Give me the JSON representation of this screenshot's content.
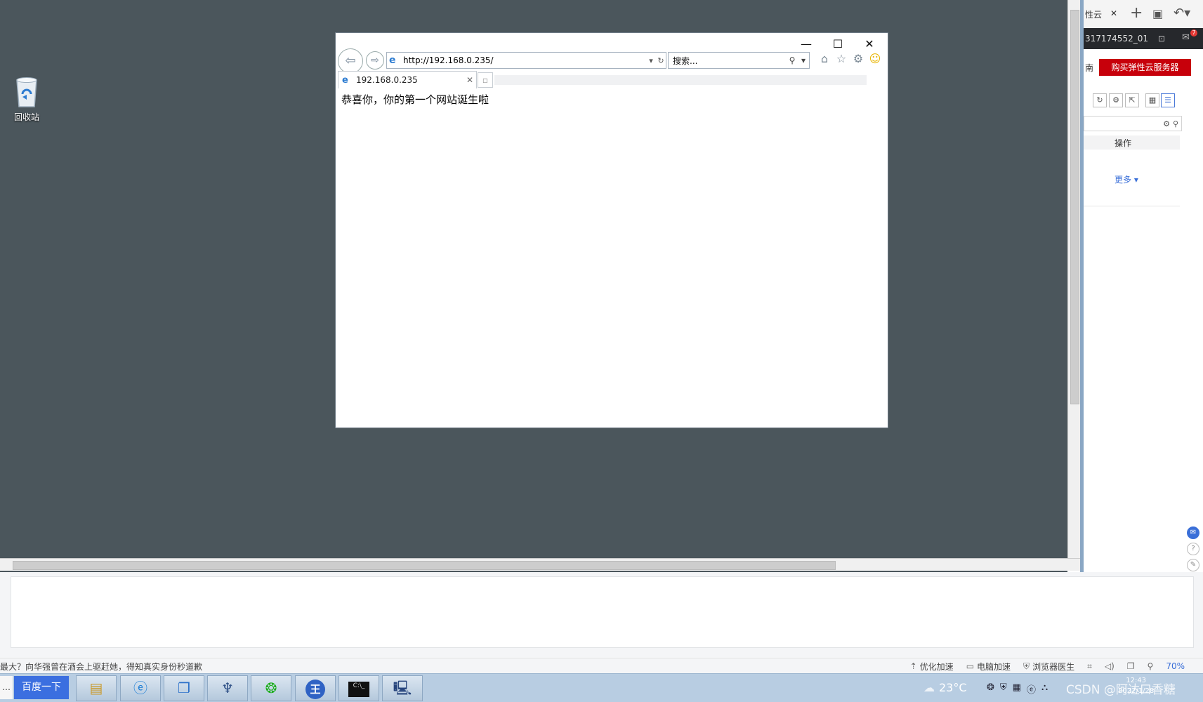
{
  "desktop": {
    "recycle_bin_label": "回收站"
  },
  "ie": {
    "minimize": "—",
    "maximize": "☐",
    "close": "✕",
    "address": "http://192.168.0.235/",
    "search_placeholder": "搜索...",
    "tab_title": "192.168.0.235",
    "page_text": "恭喜你，你的第一个网站诞生啦"
  },
  "side_panel": {
    "tab_fragment": "性云",
    "account": "317174552_01",
    "notification_count": "7",
    "nav_fragment": "南",
    "buy_button": "购买弹性云服务器",
    "table_header_op": "操作",
    "more_link": "更多 ▾"
  },
  "status_bar": {
    "news_text": "最大？向华强曾在酒会上驱赶她，得知真实身份秒道歉",
    "items": [
      "优化加速",
      "电脑加速",
      "浏览器医生"
    ],
    "zoom": "70%"
  },
  "taskbar": {
    "dots": "…",
    "baidu_button": "百度一下",
    "app6_letter": "王",
    "app7_text": "C:\\_",
    "temperature": "23°C",
    "watermark": "CSDN @阿达口香糖",
    "time": "12:43",
    "date": "2022/1/28"
  },
  "icons": [
    "recycle-bin-icon",
    "back-icon",
    "forward-icon",
    "ie-icon",
    "refresh-icon",
    "search-icon",
    "home-icon",
    "favorites-icon",
    "gear-icon",
    "smiley-icon",
    "new-tab-icon",
    "weather-icon"
  ],
  "colors": {
    "desktop_bg": "#4b565c",
    "buy_button": "#c7000b",
    "link": "#3a6fd8",
    "taskbar": "#b8cde2"
  }
}
